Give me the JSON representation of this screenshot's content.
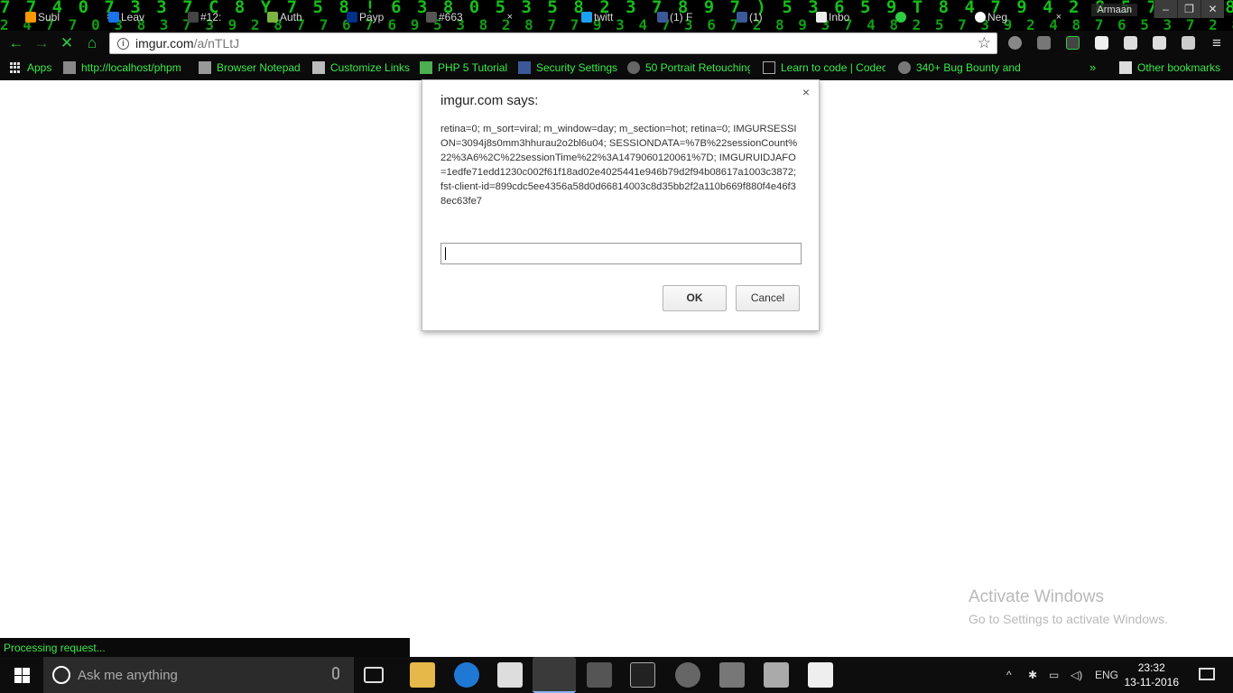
{
  "browser": {
    "tabs": [
      {
        "title": "Subl",
        "active": false
      },
      {
        "title": "Leav",
        "active": false
      },
      {
        "title": "#12:",
        "active": false
      },
      {
        "title": "Auth",
        "active": false
      },
      {
        "title": "Payp",
        "active": false
      },
      {
        "title": "#663",
        "active": false
      },
      {
        "title": "twitt",
        "active": false
      },
      {
        "title": "(1) F",
        "active": false
      },
      {
        "title": "(1)",
        "active": false
      },
      {
        "title": "Inbo",
        "active": false
      },
      {
        "title": "",
        "active": true
      },
      {
        "title": "Neg",
        "active": false
      }
    ],
    "user_name": "Armaan",
    "url_host": "imgur.com",
    "url_path": "/a/nTLtJ",
    "bookmarks": [
      {
        "label": "Apps"
      },
      {
        "label": "http://localhost/phpm"
      },
      {
        "label": "Browser Notepad"
      },
      {
        "label": "Customize Links"
      },
      {
        "label": "PHP 5 Tutorial"
      },
      {
        "label": "Security Settings"
      },
      {
        "label": "50 Portrait Retouching"
      },
      {
        "label": "Learn to code | Codec"
      },
      {
        "label": "340+ Bug Bounty and"
      },
      {
        "label": "Other bookmarks"
      }
    ],
    "bookmarks_overflow": "»",
    "status_text": "Processing request..."
  },
  "dialog": {
    "title": "imgur.com says:",
    "message": "retina=0; m_sort=viral; m_window=day; m_section=hot; retina=0; IMGURSESSION=3094j8s0mm3hhurau2o2bl6u04; SESSIONDATA=%7B%22sessionCount%22%3A6%2C%22sessionTime%22%3A1479060120061%7D; IMGURUIDJAFO=1edfe71edd1230c002f61f18ad02e4025441e946b79d2f94b08617a1003c3872; fst-client-id=899cdc5ee4356a58d0d66814003c8d35bb2f2a110b669f880f4e46f38ec63fe7",
    "input_value": "",
    "ok_label": "OK",
    "cancel_label": "Cancel",
    "close_glyph": "×"
  },
  "watermark": {
    "title": "Activate Windows",
    "subtitle": "Go to Settings to activate Windows."
  },
  "taskbar": {
    "search_placeholder": "Ask me anything",
    "language": "ENG",
    "time": "23:32",
    "date": "13-11-2016"
  },
  "colors": {
    "matrix_green": "#19d21d",
    "bookmark_text": "#3be84a",
    "chrome_bg": "#0b0b0b",
    "taskbar_bg": "#0d0d0d"
  }
}
